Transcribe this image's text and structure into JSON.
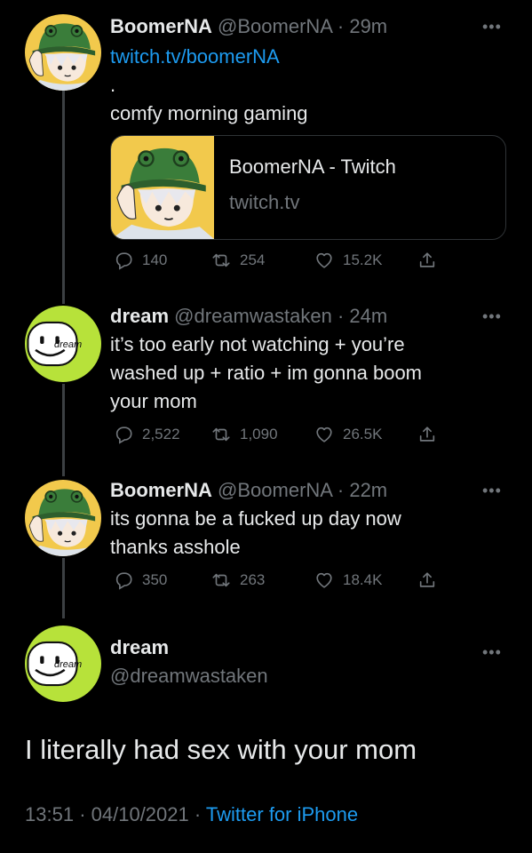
{
  "tweets": [
    {
      "name": "BoomerNA",
      "handle": "@BoomerNA",
      "time": "29m",
      "link": "twitch.tv/boomerNA",
      "dot": ".",
      "text": "comfy morning gaming",
      "card": {
        "title": "BoomerNA - Twitch",
        "domain": "twitch.tv"
      },
      "replies": "140",
      "retweets": "254",
      "likes": "15.2K"
    },
    {
      "name": "dream",
      "handle": "@dreamwastaken",
      "time": "24m",
      "lines": [
        "it’s too early not watching + you’re",
        "washed up + ratio + im gonna boom",
        "your mom"
      ],
      "avatar_label": "dream",
      "replies": "2,522",
      "retweets": "1,090",
      "likes": "26.5K"
    },
    {
      "name": "BoomerNA",
      "handle": "@BoomerNA",
      "time": "22m",
      "lines": [
        "its gonna be a fucked up day now",
        "thanks asshole"
      ],
      "replies": "350",
      "retweets": "263",
      "likes": "18.4K"
    }
  ],
  "main": {
    "name": "dream",
    "handle": "@dreamwastaken",
    "avatar_label": "dream",
    "text": "I literally had sex with your mom",
    "time": "13:51",
    "date": "04/10/2021",
    "source": "Twitter for iPhone"
  },
  "sep": "·",
  "more": "•••",
  "colors": {
    "accent": "#1d9bf0",
    "muted": "#71767b",
    "bg": "#000000",
    "dream_green": "#b7e23a",
    "avatar_yellow": "#f2c94c"
  }
}
